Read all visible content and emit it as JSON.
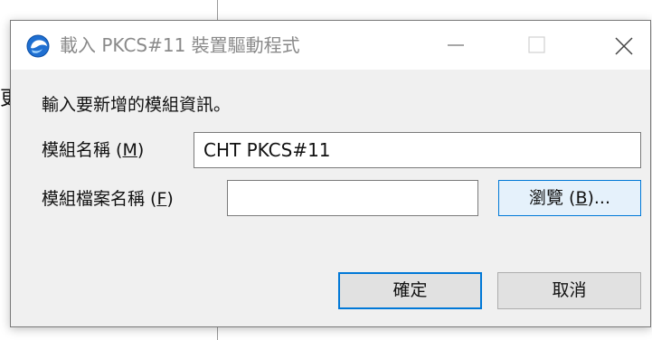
{
  "window": {
    "title": "載入 PKCS#11 裝置驅動程式",
    "icon": "thunderbird-app-icon",
    "controls": {
      "minimize": "minimize-icon",
      "maximize": "maximize-icon",
      "close": "close-icon"
    }
  },
  "background": {
    "glyph": "更"
  },
  "dialog": {
    "prompt": "輸入要新增的模組資訊。",
    "module_name": {
      "label": "模組名稱 (",
      "mnemonic": "M",
      "label_end": ")",
      "value": "CHT PKCS#11"
    },
    "module_file": {
      "label": "模組檔案名稱 (",
      "mnemonic": "F",
      "label_end": ")",
      "value": ""
    },
    "browse_button": {
      "label": "瀏覽 (",
      "mnemonic": "B",
      "label_end": ")..."
    },
    "ok_button": "確定",
    "cancel_button": "取消"
  },
  "colors": {
    "accent": "#0078d7",
    "dialog_bg": "#f0f0f0",
    "titlebar_bg": "#ffffff",
    "title_text": "#8a8a8a"
  }
}
